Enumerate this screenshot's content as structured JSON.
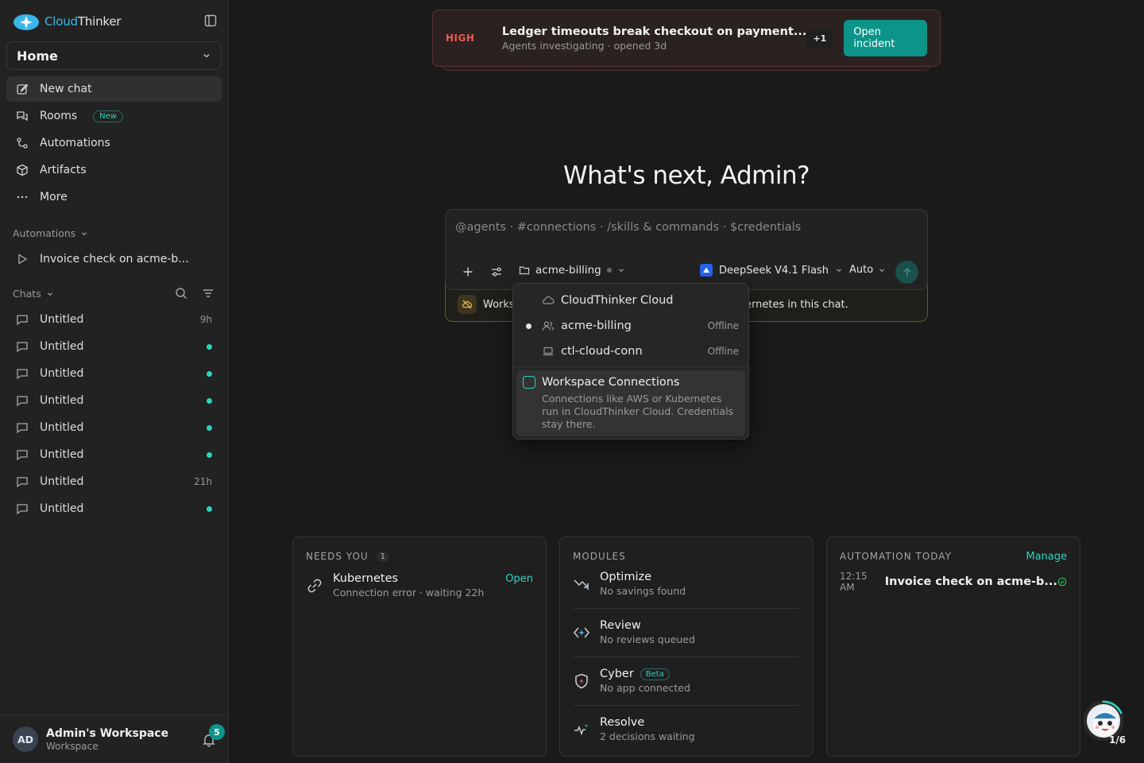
{
  "brand": {
    "name_part1": "Cloud",
    "name_part2": "Thinker",
    "accent": "#2dd4bf"
  },
  "sidebar": {
    "workspace_select": "Home",
    "nav": [
      {
        "label": "New chat",
        "icon": "edit-icon",
        "active": true
      },
      {
        "label": "Rooms",
        "icon": "rooms-icon",
        "badge": "New"
      },
      {
        "label": "Automations",
        "icon": "automations-icon"
      },
      {
        "label": "Artifacts",
        "icon": "box-icon"
      },
      {
        "label": "More",
        "icon": "more-icon"
      }
    ],
    "automations_label": "Automations",
    "automations": [
      {
        "label": "Invoice check on acme-b..."
      }
    ],
    "chats_label": "Chats",
    "chats": [
      {
        "title": "Untitled",
        "meta": "9h"
      },
      {
        "title": "Untitled",
        "unread": true
      },
      {
        "title": "Untitled",
        "unread": true
      },
      {
        "title": "Untitled",
        "unread": true
      },
      {
        "title": "Untitled",
        "unread": true
      },
      {
        "title": "Untitled",
        "unread": true
      },
      {
        "title": "Untitled",
        "meta": "21h"
      },
      {
        "title": "Untitled",
        "unread": true
      }
    ],
    "footer": {
      "initials": "AD",
      "name": "Admin's Workspace",
      "sub": "Workspace",
      "notifications": "5"
    }
  },
  "incident": {
    "severity": "HIGH",
    "title": "Ledger timeouts break checkout on payment...",
    "subtitle": "Agents investigating · opened 3d",
    "extra": "+1",
    "action": "Open incident"
  },
  "headline": "What's next, Admin?",
  "composer": {
    "placeholder": "@agents · #connections · /skills & commands · $credentials",
    "connection": "acme-billing",
    "model": "DeepSeek V4.1 Flash",
    "mode": "Auto",
    "notice_left": "Works",
    "notice_right": "ernetes in this chat."
  },
  "connection_menu": {
    "items": [
      {
        "label": "CloudThinker Cloud",
        "icon": "cloud-icon",
        "status": ""
      },
      {
        "label": "acme-billing",
        "icon": "users-icon",
        "status": "Offline",
        "selected": true
      },
      {
        "label": "ctl-cloud-conn",
        "icon": "laptop-icon",
        "status": "Offline"
      }
    ],
    "workspace": {
      "title": "Workspace Connections",
      "desc": "Connections like AWS or Kubernetes run in CloudThinker Cloud. Credentials stay there."
    }
  },
  "cards": {
    "needs_you": {
      "header": "NEEDS YOU",
      "count": "1",
      "item": {
        "title": "Kubernetes",
        "sub": "Connection error · waiting 22h",
        "action": "Open"
      }
    },
    "modules": {
      "header": "MODULES",
      "items": [
        {
          "title": "Optimize",
          "sub": "No savings found"
        },
        {
          "title": "Review",
          "sub": "No reviews queued"
        },
        {
          "title": "Cyber",
          "sub": "No app connected",
          "badge": "Beta"
        },
        {
          "title": "Resolve",
          "sub": "2 decisions waiting"
        }
      ]
    },
    "automation_today": {
      "header": "AUTOMATION TODAY",
      "action": "Manage",
      "item": {
        "time": "12:15 AM",
        "name": "Invoice check on acme-b..."
      }
    }
  },
  "assistant": {
    "progress": "1/6"
  }
}
